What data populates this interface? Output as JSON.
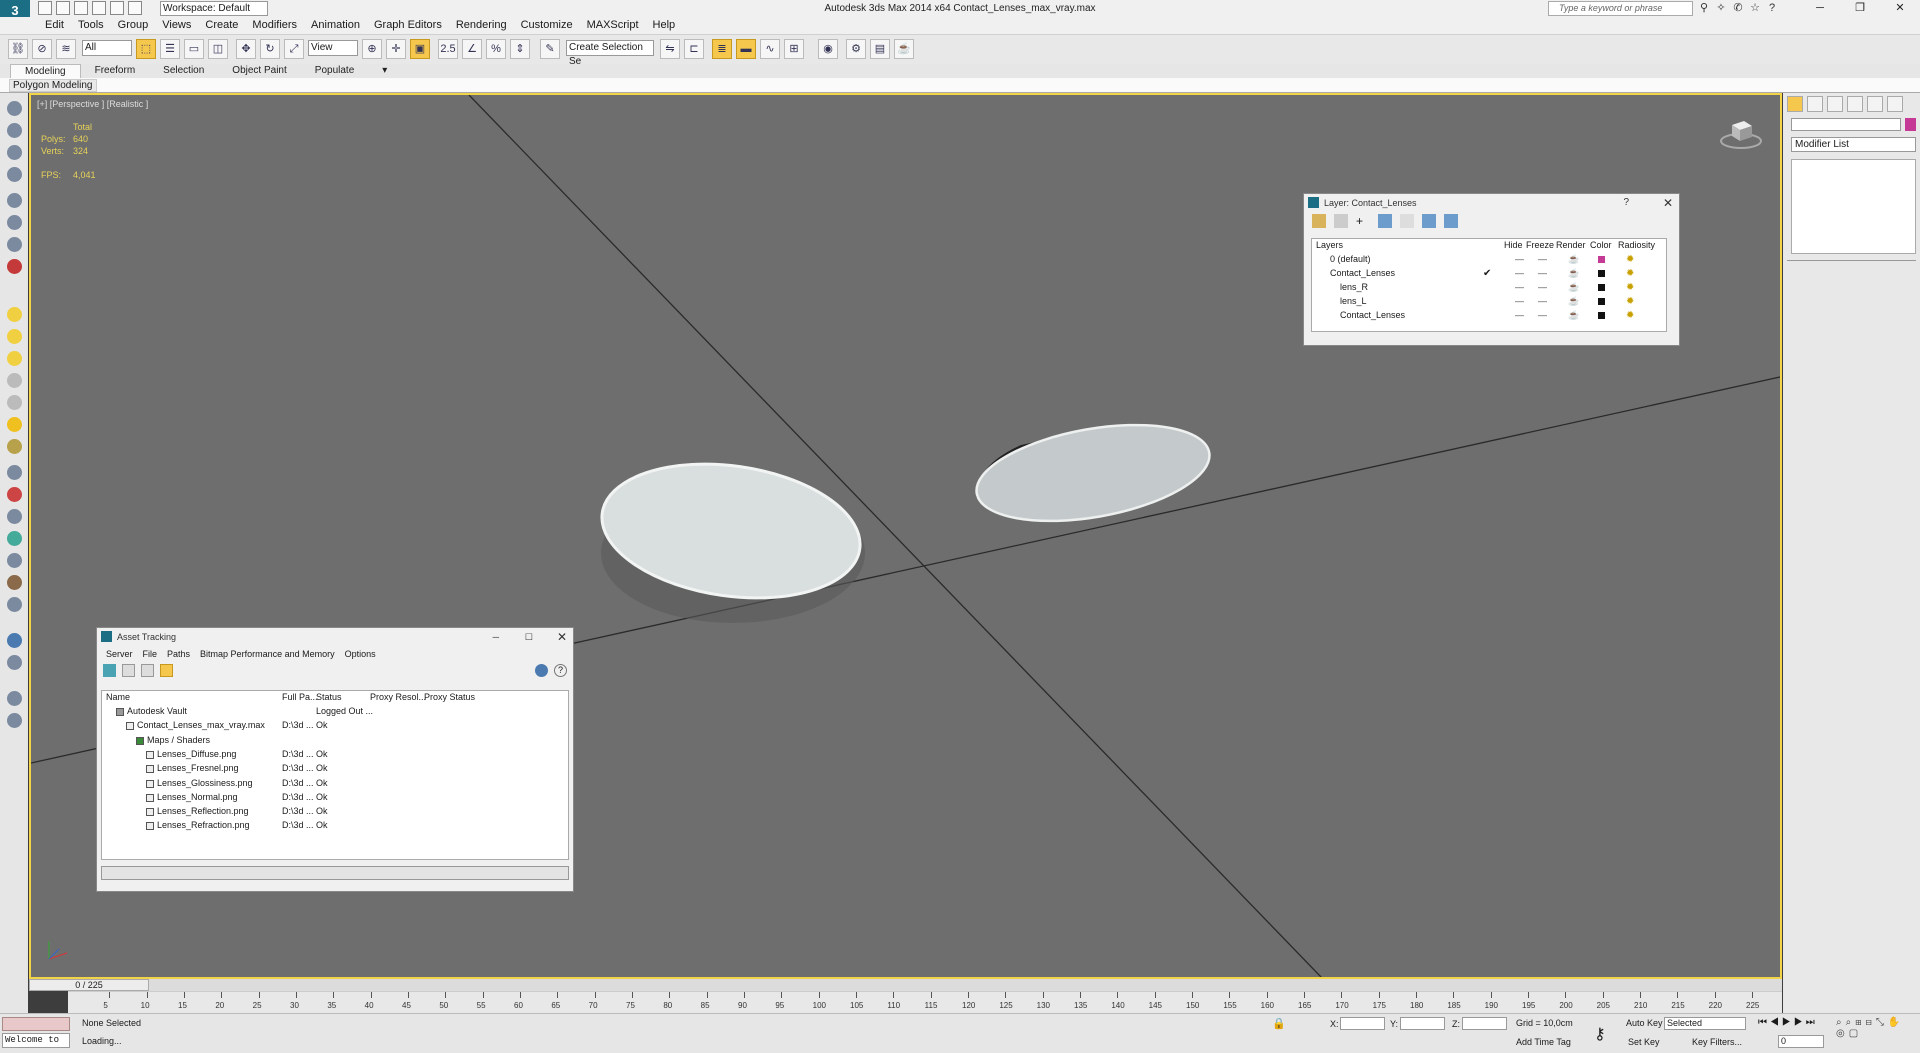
{
  "titlebar": {
    "title": "Autodesk 3ds Max  2014 x64     Contact_Lenses_max_vray.max",
    "workspace": "Workspace: Default",
    "search_placeholder": "Type a keyword or phrase",
    "logo": "3"
  },
  "menus": [
    "Edit",
    "Tools",
    "Group",
    "Views",
    "Create",
    "Modifiers",
    "Animation",
    "Graph Editors",
    "Rendering",
    "Customize",
    "MAXScript",
    "Help"
  ],
  "toolbar": {
    "selection_filter": "All",
    "ref_coord": "View",
    "named_selection": "Create Selection Se",
    "snap_label": "2.5"
  },
  "ribbon": {
    "tabs": [
      "Modeling",
      "Freeform",
      "Selection",
      "Object Paint",
      "Populate"
    ],
    "active_tab": "Modeling",
    "panel_label": "Polygon Modeling"
  },
  "viewport": {
    "label": "[+] [Perspective ] [Realistic ]",
    "stats_header": "Total",
    "polys_label": "Polys:",
    "polys_value": "640",
    "verts_label": "Verts:",
    "verts_value": "324",
    "fps_label": "FPS:",
    "fps_value": "4,041"
  },
  "layer_dialog": {
    "title": "Layer: Contact_Lenses",
    "columns": [
      "Layers",
      "Hide",
      "Freeze",
      "Render",
      "Color",
      "Radiosity"
    ],
    "rows": [
      {
        "name": "0 (default)",
        "indent": 0,
        "selected": false,
        "color": "#c43a95"
      },
      {
        "name": "Contact_Lenses",
        "indent": 0,
        "selected": true,
        "color": "#111111"
      },
      {
        "name": "lens_R",
        "indent": 1,
        "selected": false,
        "color": "#111111"
      },
      {
        "name": "lens_L",
        "indent": 1,
        "selected": false,
        "color": "#111111"
      },
      {
        "name": "Contact_Lenses",
        "indent": 1,
        "selected": false,
        "color": "#111111"
      }
    ]
  },
  "asset_tracking": {
    "title": "Asset Tracking",
    "menus": [
      "Server",
      "File",
      "Paths",
      "Bitmap Performance and Memory",
      "Options"
    ],
    "columns": [
      "Name",
      "Full Pa...",
      "Status",
      "Proxy Resol...",
      "Proxy Status"
    ],
    "rows": [
      {
        "name": "Autodesk Vault",
        "path": "",
        "status": "Logged Out ...",
        "indent": 1
      },
      {
        "name": "Contact_Lenses_max_vray.max",
        "path": "D:\\3d ...",
        "status": "Ok",
        "indent": 2
      },
      {
        "name": "Maps / Shaders",
        "path": "",
        "status": "",
        "indent": 3
      },
      {
        "name": "Lenses_Diffuse.png",
        "path": "D:\\3d ...",
        "status": "Ok",
        "indent": 4
      },
      {
        "name": "Lenses_Fresnel.png",
        "path": "D:\\3d ...",
        "status": "Ok",
        "indent": 4
      },
      {
        "name": "Lenses_Glossiness.png",
        "path": "D:\\3d ...",
        "status": "Ok",
        "indent": 4
      },
      {
        "name": "Lenses_Normal.png",
        "path": "D:\\3d ...",
        "status": "Ok",
        "indent": 4
      },
      {
        "name": "Lenses_Reflection.png",
        "path": "D:\\3d ...",
        "status": "Ok",
        "indent": 4
      },
      {
        "name": "Lenses_Refraction.png",
        "path": "D:\\3d ...",
        "status": "Ok",
        "indent": 4
      }
    ]
  },
  "command_panel": {
    "modifier_list": "Modifier List",
    "object_color": "#c43a95"
  },
  "timeline": {
    "frame_counter": "0 / 225",
    "ticks": [
      "5",
      "10",
      "15",
      "20",
      "25",
      "30",
      "35",
      "40",
      "45",
      "50",
      "55",
      "60",
      "65",
      "70",
      "75",
      "80",
      "85",
      "90",
      "95",
      "100",
      "105",
      "110",
      "115",
      "120",
      "125",
      "130",
      "135",
      "140",
      "145",
      "150",
      "155",
      "160",
      "165",
      "170",
      "175",
      "180",
      "185",
      "190",
      "195",
      "200",
      "205",
      "210",
      "215",
      "220",
      "225"
    ]
  },
  "statusbar": {
    "selection": "None Selected",
    "prompt": "Loading...",
    "welcome": "Welcome to M",
    "x_label": "X:",
    "y_label": "Y:",
    "z_label": "Z:",
    "grid": "Grid = 10,0cm",
    "add_time_tag": "Add Time Tag",
    "auto_key": "Auto Key",
    "set_key": "Set Key",
    "key_mode": "Selected",
    "key_filters": "Key Filters...",
    "frame": "0"
  }
}
